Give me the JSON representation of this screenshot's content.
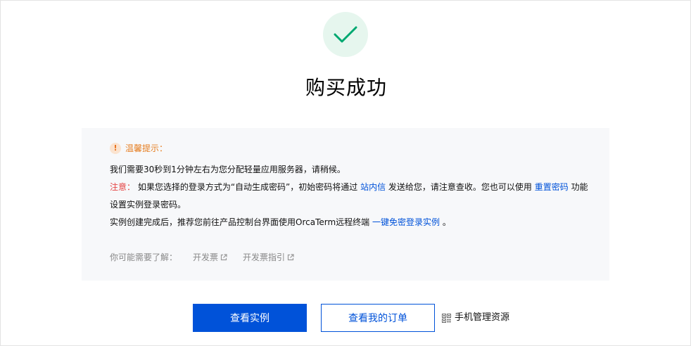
{
  "title": "购买成功",
  "tips": {
    "heading": "温馨提示：",
    "line1": "我们需要30秒到1分钟左右为您分配轻量应用服务器，请稍候。",
    "notice_label": "注意：",
    "notice_pre": " 如果您选择的登录方式为“自动生成密码”，初始密码将通过 ",
    "notice_link1": "站内信",
    "notice_mid": " 发送给您，请注意查收。您也可以使用 ",
    "notice_link2": "重置密码",
    "notice_post": " 功能设置实例登录密码。",
    "line3_pre": "实例创建完成后，推荐您前往产品控制台界面使用OrcaTerm远程终端 ",
    "line3_link": "一键免密登录实例",
    "line3_post": " 。"
  },
  "learn_more": {
    "label": "你可能需要了解：",
    "items": [
      "开发票",
      "开发票指引"
    ]
  },
  "actions": {
    "view_instance": "查看实例",
    "view_orders": "查看我的订单",
    "mobile_manage": "手机管理资源"
  },
  "colors": {
    "primary": "#0052d9",
    "success": "#00a870",
    "warning": "#e67e22",
    "danger": "#e54545"
  },
  "icons": {
    "success": "checkmark-icon",
    "warning": "exclamation-icon",
    "external": "external-link-icon",
    "qr": "qr-code-icon"
  }
}
